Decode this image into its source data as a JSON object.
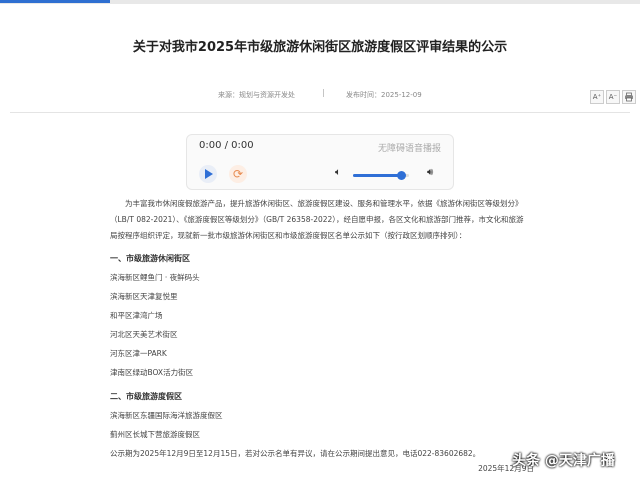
{
  "article": {
    "title": "关于对我市2025年市级旅游休闲街区旅游度假区评审结果的公示",
    "source": "来源：规划与资源开发处",
    "separator": "|",
    "publish_time": "发布时间：2025-12-09"
  },
  "tools": {
    "font_larger": "A⁺",
    "font_smaller": "A⁻",
    "print_icon": "print-icon"
  },
  "player": {
    "time": "0:00 / 0:00",
    "a11y_label": "无障碍语音播报",
    "volume_fraction": 0.85
  },
  "content": {
    "intro": "为丰富我市休闲度假旅游产品，提升旅游休闲街区、旅游度假区建设、服务和管理水平，依据《旅游休闲街区等级划分》（LB/T 082-2021）、《旅游度假区等级划分》（GB/T 26358-2022），经自愿申报，各区文化和旅游部门推荐，市文化和旅游局按程序组织评定，现就新一批市级旅游休闲街区和市级旅游度假区名单公示如下（按行政区划顺序排列）：",
    "section1_heading": "一、市级旅游休闲街区",
    "section1_items": [
      "滨海新区鲤鱼门 · 夜鲜码头",
      "滨海新区天津复悦里",
      "和平区津湾广场",
      "河北区天美艺术街区",
      "河东区津一PARK",
      "津南区绿动BOX活力街区"
    ],
    "section2_heading": "二、市级旅游度假区",
    "section2_items": [
      "滨海新区东疆国际海洋旅游度假区",
      "蓟州区长城下营旅游度假区"
    ],
    "notice": "公示期为2025年12月9日至12月15日，若对公示名单有异议，请在公示期间提出意见，电话022-83602682。",
    "date": "2025年12月9日"
  },
  "watermark": "头条 @天津广播"
}
